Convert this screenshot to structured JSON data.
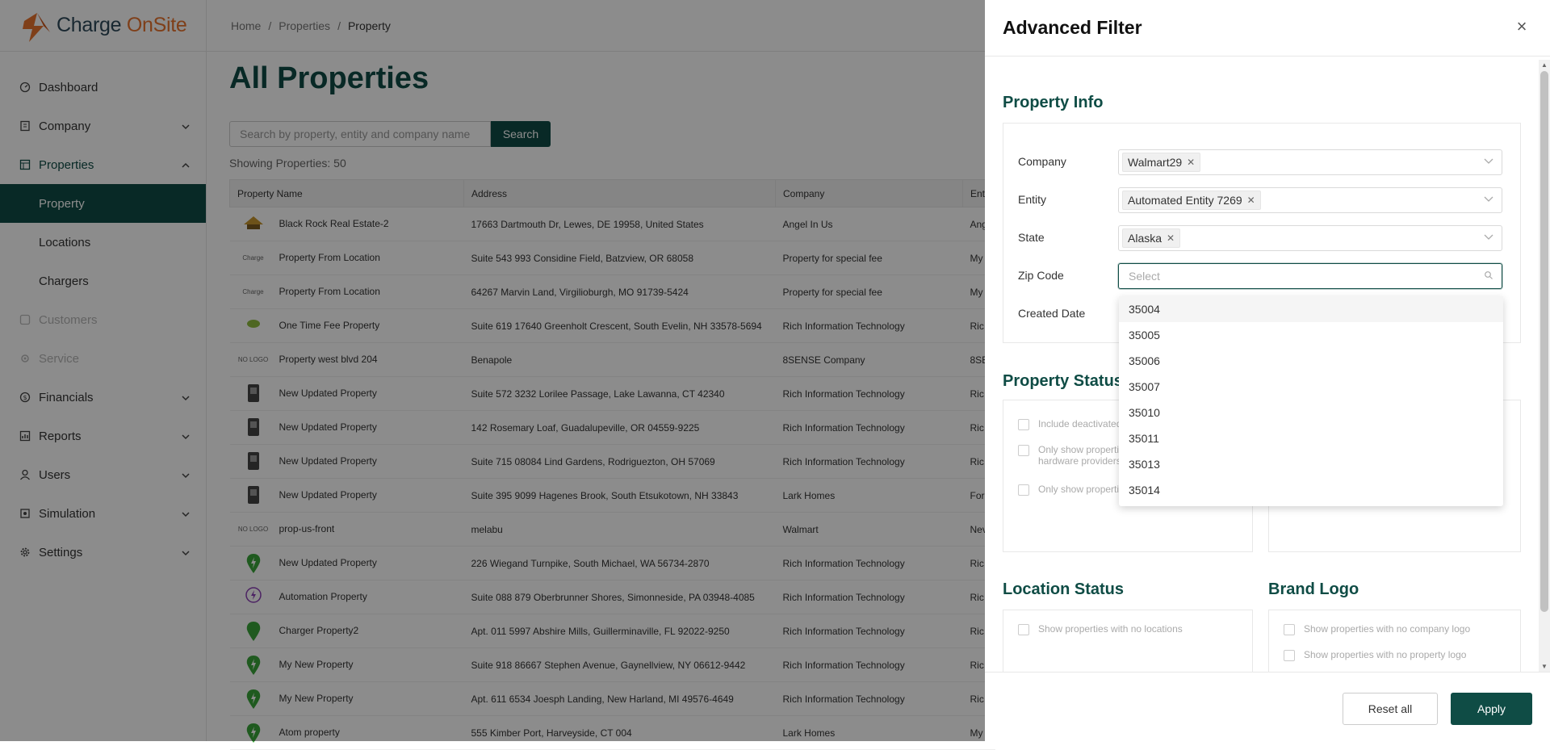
{
  "app": {
    "name_part1": "Charge",
    "name_part2": " OnSite"
  },
  "breadcrumb": [
    "Home",
    "Properties",
    "Property"
  ],
  "sidebar": {
    "items": [
      {
        "label": "Dashboard"
      },
      {
        "label": "Company"
      },
      {
        "label": "Properties"
      },
      {
        "label": "Property"
      },
      {
        "label": "Locations"
      },
      {
        "label": "Chargers"
      },
      {
        "label": "Customers"
      },
      {
        "label": "Service"
      },
      {
        "label": "Financials"
      },
      {
        "label": "Reports"
      },
      {
        "label": "Users"
      },
      {
        "label": "Simulation"
      },
      {
        "label": "Settings"
      }
    ]
  },
  "main": {
    "title": "All Properties",
    "search_placeholder": "Search by property, entity and company name",
    "search_button": "Search",
    "count": "Showing Properties: 50",
    "columns": [
      "Property Name",
      "Address",
      "Company",
      "Ent"
    ],
    "rows": [
      {
        "logo": "",
        "name": "Black Rock Real Estate-2",
        "address": "17663 Dartmouth Dr, Lewes, DE 19958, United States",
        "company": "Angel In Us",
        "entity": "Ang"
      },
      {
        "logo": "Charge",
        "name": "Property From Location",
        "address": "Suite 543 993 Considine Field, Batzview, OR 68058",
        "company": "Property for special fee",
        "entity": "My"
      },
      {
        "logo": "Charge",
        "name": "Property From Location",
        "address": "64267 Marvin Land, Virgilioburgh, MO 91739-5424",
        "company": "Property for special fee",
        "entity": "My"
      },
      {
        "logo": "",
        "name": "One Time Fee Property",
        "address": "Suite 619 17640 Greenholt Crescent, South Evelin, NH 33578-5694",
        "company": "Rich Information Technology",
        "entity": "Ric"
      },
      {
        "logo": "NO LOGO",
        "name": "Property west blvd 204",
        "address": "Benapole",
        "company": "8SENSE Company",
        "entity": "8SE"
      },
      {
        "logo": "",
        "name": "New Updated Property",
        "address": "Suite 572 3232 Lorilee Passage, Lake Lawanna, CT 42340",
        "company": "Rich Information Technology",
        "entity": "Ric"
      },
      {
        "logo": "",
        "name": "New Updated Property",
        "address": "142 Rosemary Loaf, Guadalupeville, OR 04559-9225",
        "company": "Rich Information Technology",
        "entity": "Ric"
      },
      {
        "logo": "",
        "name": "New Updated Property",
        "address": "Suite 715 08084 Lind Gardens, Rodriguezton, OH 57069",
        "company": "Rich Information Technology",
        "entity": "Ric"
      },
      {
        "logo": "",
        "name": "New Updated Property",
        "address": "Suite 395 9099 Hagenes Brook, South Etsukotown, NH 33843",
        "company": "Lark Homes",
        "entity": "For"
      },
      {
        "logo": "NO LOGO",
        "name": "prop-us-front",
        "address": "melabu",
        "company": "Walmart",
        "entity": "Nev"
      },
      {
        "logo": "",
        "name": "New Updated Property",
        "address": "226 Wiegand Turnpike, South Michael, WA 56734-2870",
        "company": "Rich Information Technology",
        "entity": "Ric"
      },
      {
        "logo": "",
        "name": "Automation Property",
        "address": "Suite 088 879 Oberbrunner Shores, Simonneside, PA 03948-4085",
        "company": "Rich Information Technology",
        "entity": "Ric"
      },
      {
        "logo": "",
        "name": "Charger Property2",
        "address": "Apt. 011 5997 Abshire Mills, Guillerminaville, FL 92022-9250",
        "company": "Rich Information Technology",
        "entity": "Ric"
      },
      {
        "logo": "",
        "name": "My New Property",
        "address": "Suite 918 86667 Stephen Avenue, Gaynellview, NY 06612-9442",
        "company": "Rich Information Technology",
        "entity": "Ric"
      },
      {
        "logo": "",
        "name": "My New Property",
        "address": "Apt. 611 6534 Joesph Landing, New Harland, MI 49576-4649",
        "company": "Rich Information Technology",
        "entity": "Ric"
      },
      {
        "logo": "",
        "name": "Atom property",
        "address": "555 Kimber Port, Harveyside, CT 004",
        "company": "Lark Homes",
        "entity": "My"
      }
    ]
  },
  "filter": {
    "title": "Advanced Filter",
    "property_info": {
      "heading": "Property Info",
      "company_label": "Company",
      "company_tag": "Walmart29",
      "entity_label": "Entity",
      "entity_tag": "Automated Entity 7269",
      "state_label": "State",
      "state_tag": "Alaska",
      "zip_label": "Zip Code",
      "zip_placeholder": "Select",
      "created_label": "Created Date"
    },
    "zip_options": [
      "35004",
      "35005",
      "35006",
      "35007",
      "35010",
      "35011",
      "35013",
      "35014"
    ],
    "property_status": {
      "heading": "Property Status",
      "opt1": "Include deactivated",
      "opt2a": "Only show properti",
      "opt2b": "hardware providers",
      "opt3": "Only show properti"
    },
    "location_status": {
      "heading": "Location Status",
      "opt1": "Show properties with no locations"
    },
    "brand_logo": {
      "heading": "Brand Logo",
      "opt1": "Show properties with no company logo",
      "opt2": "Show properties with no property logo"
    },
    "reset_label": "Reset all",
    "apply_label": "Apply"
  },
  "colors": {
    "brand": "#0f4c45",
    "accent": "#e8742f"
  }
}
